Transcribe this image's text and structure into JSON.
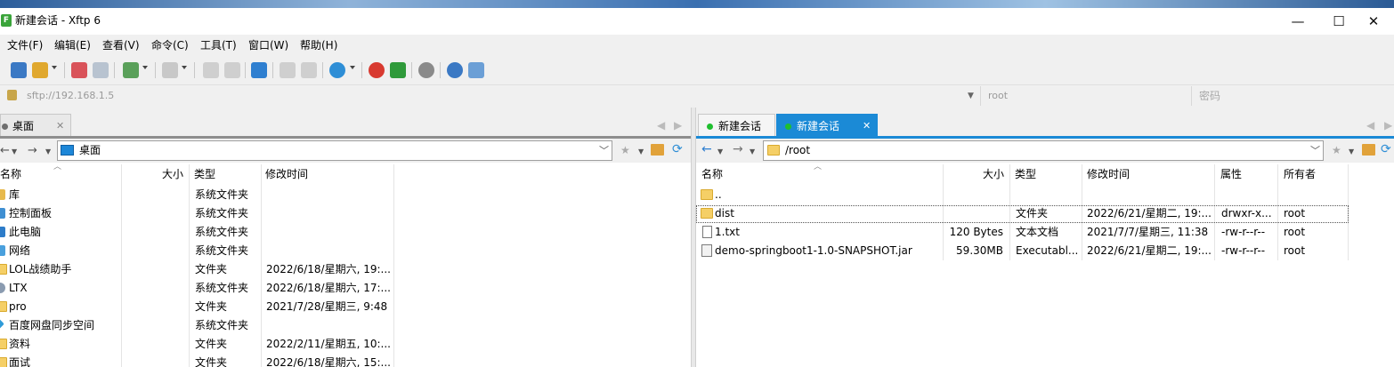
{
  "window": {
    "title": "新建会话 - Xftp 6",
    "app_icon": "xftp-icon",
    "controls": {
      "minimize": "—",
      "maximize": "☐",
      "close": "✕"
    }
  },
  "menu": [
    "文件(F)",
    "编辑(E)",
    "查看(V)",
    "命令(C)",
    "工具(T)",
    "窗口(W)",
    "帮助(H)"
  ],
  "address": {
    "url": "sftp://192.168.1.5",
    "user_value": "root",
    "password_placeholder": "密码"
  },
  "left_pane": {
    "tab_label": "桌面",
    "path": "桌面",
    "columns": [
      "名称",
      "大小",
      "类型",
      "修改时间"
    ],
    "rows": [
      {
        "name": "库",
        "size": "",
        "type": "系统文件夹",
        "modified": "",
        "icon": "library-icon"
      },
      {
        "name": "控制面板",
        "size": "",
        "type": "系统文件夹",
        "modified": "",
        "icon": "control-panel-icon"
      },
      {
        "name": "此电脑",
        "size": "",
        "type": "系统文件夹",
        "modified": "",
        "icon": "computer-icon"
      },
      {
        "name": "网络",
        "size": "",
        "type": "系统文件夹",
        "modified": "",
        "icon": "network-icon"
      },
      {
        "name": "LOL战绩助手",
        "size": "",
        "type": "文件夹",
        "modified": "2022/6/18/星期六, 19:...",
        "icon": "folder-icon"
      },
      {
        "name": "LTX",
        "size": "",
        "type": "系统文件夹",
        "modified": "2022/6/18/星期六, 17:...",
        "icon": "user-folder-icon"
      },
      {
        "name": "pro",
        "size": "",
        "type": "文件夹",
        "modified": "2021/7/28/星期三, 9:48",
        "icon": "folder-icon"
      },
      {
        "name": "百度网盘同步空间",
        "size": "",
        "type": "系统文件夹",
        "modified": "",
        "icon": "sync-folder-icon"
      },
      {
        "name": "资料",
        "size": "",
        "type": "文件夹",
        "modified": "2022/2/11/星期五, 10:...",
        "icon": "folder-icon"
      },
      {
        "name": "面试",
        "size": "",
        "type": "文件夹",
        "modified": "2022/6/18/星期六, 15:...",
        "icon": "folder-icon"
      }
    ]
  },
  "right_pane": {
    "tabs": [
      "新建会话",
      "新建会话"
    ],
    "path": "/root",
    "columns": [
      "名称",
      "大小",
      "类型",
      "修改时间",
      "属性",
      "所有者"
    ],
    "rows": [
      {
        "name": "..",
        "size": "",
        "type": "",
        "modified": "",
        "attrs": "",
        "owner": "",
        "icon": "folder-icon"
      },
      {
        "name": "dist",
        "size": "",
        "type": "文件夹",
        "modified": "2022/6/21/星期二, 19:...",
        "attrs": "drwxr-x...",
        "owner": "root",
        "icon": "folder-icon"
      },
      {
        "name": "1.txt",
        "size": "120 Bytes",
        "type": "文本文档",
        "modified": "2021/7/7/星期三, 11:38",
        "attrs": "-rw-r--r--",
        "owner": "root",
        "icon": "text-file-icon"
      },
      {
        "name": "demo-springboot1-1.0-SNAPSHOT.jar",
        "size": "59.30MB",
        "type": "Executabl...",
        "modified": "2022/6/21/星期二, 19:...",
        "attrs": "-rw-r--r--",
        "owner": "root",
        "icon": "jar-file-icon"
      }
    ]
  },
  "colors": {
    "active_tab": "#1b8ad6",
    "active_dot": "#1fbf2f",
    "folder": "#f5cf66"
  }
}
